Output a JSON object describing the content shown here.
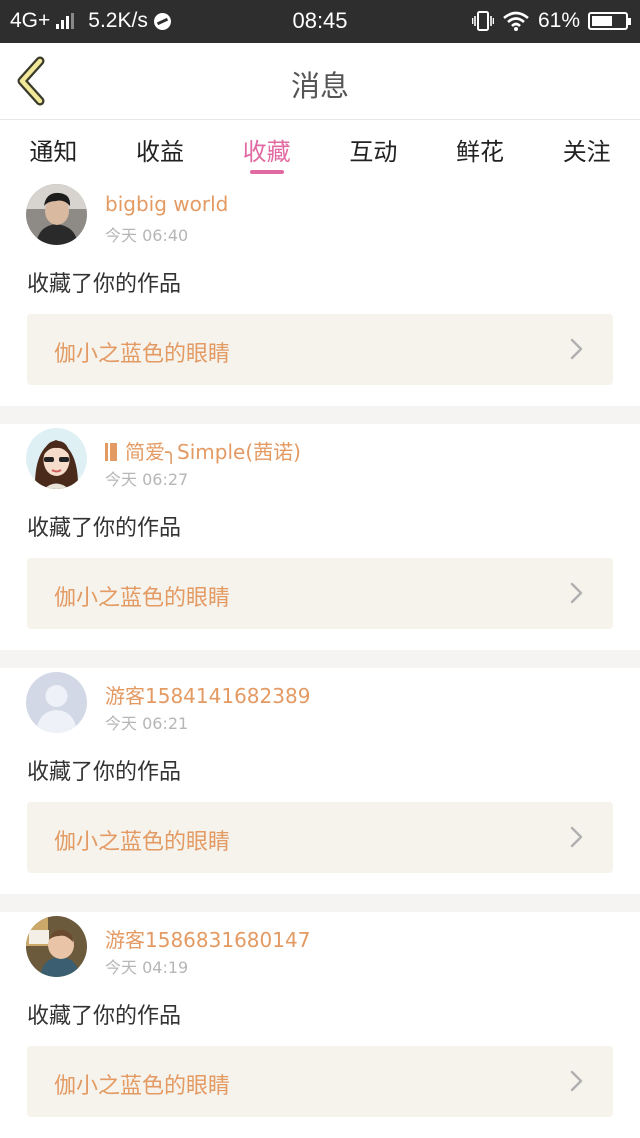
{
  "status_bar": {
    "network": "4G+",
    "speed": "5.2K/s",
    "time": "08:45",
    "battery": "61%",
    "battery_level": 0.61
  },
  "header": {
    "title": "消息",
    "back_icon": "chevron-left-icon"
  },
  "tabs": [
    {
      "label": "通知",
      "active": false
    },
    {
      "label": "收益",
      "active": false
    },
    {
      "label": "收藏",
      "active": true
    },
    {
      "label": "互动",
      "active": false
    },
    {
      "label": "鲜花",
      "active": false
    },
    {
      "label": "关注",
      "active": false
    }
  ],
  "colors": {
    "accent": "#e26aa2",
    "name": "#e39a63",
    "box_bg": "#f5f3ec",
    "status_bar": "#2e2e2e"
  },
  "messages": [
    {
      "user": "bigbig world",
      "time": "今天 06:40",
      "text": "收藏了你的作品",
      "work": "伽小之蓝色的眼睛",
      "avatar": "photo-avatar-male",
      "badge": false
    },
    {
      "user": "简爱╮Simple(茜诺)",
      "time": "今天 06:27",
      "text": "收藏了你的作品",
      "work": "伽小之蓝色的眼睛",
      "avatar": "cartoon-avatar-girl",
      "badge": true
    },
    {
      "user": "游客1584141682389",
      "time": "今天 06:21",
      "text": "收藏了你的作品",
      "work": "伽小之蓝色的眼睛",
      "avatar": "default-avatar",
      "badge": false
    },
    {
      "user": "游客1586831680147",
      "time": "今天 04:19",
      "text": "收藏了你的作品",
      "work": "伽小之蓝色的眼睛",
      "avatar": "photo-avatar-baby",
      "badge": false
    }
  ]
}
